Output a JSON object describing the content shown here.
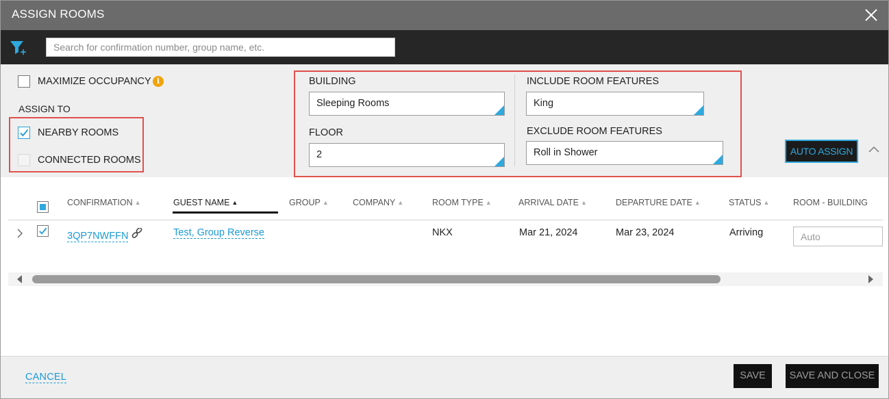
{
  "dialog": {
    "title": "ASSIGN ROOMS"
  },
  "search": {
    "placeholder": "Search for confirmation number, group name, etc."
  },
  "options": {
    "maximize_occupancy_label": "MAXIMIZE OCCUPANCY",
    "maximize_occupancy_checked": false,
    "assign_to_label": "ASSIGN TO",
    "nearby_rooms_label": "NEARBY ROOMS",
    "nearby_rooms_checked": true,
    "connected_rooms_label": "CONNECTED ROOMS",
    "connected_rooms_checked": false,
    "building_label": "BUILDING",
    "building_value": "Sleeping Rooms",
    "floor_label": "FLOOR",
    "floor_value": "2",
    "include_features_label": "INCLUDE ROOM FEATURES",
    "include_features_value": "King",
    "exclude_features_label": "EXCLUDE ROOM FEATURES",
    "exclude_features_value": "Roll in Shower",
    "auto_assign_label": "AUTO ASSIGN"
  },
  "grid": {
    "columns": [
      {
        "label": "CONFIRMATION",
        "sort": "none"
      },
      {
        "label": "GUEST NAME",
        "sort": "ascending"
      },
      {
        "label": "GROUP",
        "sort": "none"
      },
      {
        "label": "COMPANY",
        "sort": "none"
      },
      {
        "label": "ROOM TYPE",
        "sort": "none"
      },
      {
        "label": "ARRIVAL DATE",
        "sort": "none"
      },
      {
        "label": "DEPARTURE DATE",
        "sort": "none"
      },
      {
        "label": "STATUS",
        "sort": "none"
      },
      {
        "label": "ROOM - BUILDING"
      }
    ],
    "rows": [
      {
        "selected": true,
        "confirmation": "3QP7NWFFN",
        "guest_name": "Test, Group Reverse",
        "group": "",
        "company": "",
        "room_type": "NKX",
        "arrival_date": "Mar 21, 2024",
        "departure_date": "Mar 23, 2024",
        "status": "Arriving",
        "room_placeholder": "Auto"
      }
    ]
  },
  "footer": {
    "cancel_label": "CANCEL",
    "save_label": "SAVE",
    "save_close_label": "SAVE AND CLOSE"
  },
  "colors": {
    "accent": "#2fa9de",
    "highlight": "#e0504b",
    "title_bar": "#6b6b6b",
    "search_bar": "#262626",
    "info": "#f0a30a"
  }
}
